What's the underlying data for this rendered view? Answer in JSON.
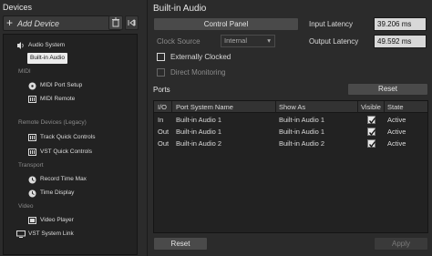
{
  "left": {
    "title": "Devices",
    "add_device": "Add Device",
    "tree": [
      {
        "type": "item",
        "label": "Audio System",
        "icon": "audio-system-icon"
      },
      {
        "type": "item",
        "label": "Built-in Audio",
        "icon": "",
        "selected": true
      },
      {
        "type": "category",
        "label": "MIDI"
      },
      {
        "type": "item",
        "label": "MIDI Port Setup",
        "icon": "midi-port-icon"
      },
      {
        "type": "item",
        "label": "MIDI Remote",
        "icon": "midi-remote-icon"
      },
      {
        "type": "category",
        "label": "Remote Devices (Legacy)"
      },
      {
        "type": "item",
        "label": "Track Quick Controls",
        "icon": "quick-controls-icon"
      },
      {
        "type": "item",
        "label": "VST Quick Controls",
        "icon": "quick-controls-icon"
      },
      {
        "type": "category",
        "label": "Transport"
      },
      {
        "type": "item",
        "label": "Record Time Max",
        "icon": "clock-icon"
      },
      {
        "type": "item",
        "label": "Time Display",
        "icon": "clock-icon"
      },
      {
        "type": "category",
        "label": "Video"
      },
      {
        "type": "item",
        "label": "Video Player",
        "icon": "video-icon"
      },
      {
        "type": "item",
        "label": "VST System Link",
        "icon": "monitor-icon"
      }
    ]
  },
  "right": {
    "title": "Built-in Audio",
    "control_panel": "Control Panel",
    "input_latency_label": "Input Latency",
    "input_latency_value": "39.206 ms",
    "output_latency_label": "Output Latency",
    "output_latency_value": "49.592 ms",
    "clock_source_label": "Clock Source",
    "clock_source_value": "Internal",
    "externally_clocked": "Externally Clocked",
    "direct_monitoring": "Direct Monitoring",
    "ports_title": "Ports",
    "ports_reset": "Reset",
    "columns": [
      "I/O",
      "Port System Name",
      "Show As",
      "Visible",
      "State"
    ],
    "rows": [
      {
        "io": "In",
        "system_name": "Built-in Audio 1",
        "show_as": "Built-in Audio 1",
        "visible": true,
        "state": "Active"
      },
      {
        "io": "Out",
        "system_name": "Built-in Audio 1",
        "show_as": "Built-in Audio 1",
        "visible": true,
        "state": "Active"
      },
      {
        "io": "Out",
        "system_name": "Built-in Audio 2",
        "show_as": "Built-in Audio 2",
        "visible": true,
        "state": "Active"
      }
    ],
    "reset": "Reset",
    "apply": "Apply"
  }
}
